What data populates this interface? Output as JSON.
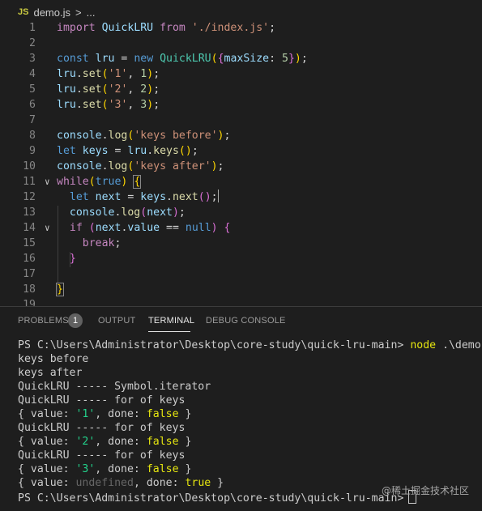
{
  "breadcrumb": {
    "file_icon": "JS",
    "file": "demo.js",
    "separator": ">",
    "ellipsis": "..."
  },
  "editor": {
    "lines": [
      {
        "num": "1",
        "tokens": [
          {
            "t": "import",
            "c": "k"
          },
          {
            "t": " "
          },
          {
            "t": "QuickLRU",
            "c": "v"
          },
          {
            "t": " "
          },
          {
            "t": "from",
            "c": "k"
          },
          {
            "t": " "
          },
          {
            "t": "'./index.js'",
            "c": "s"
          },
          {
            "t": ";",
            "c": "p"
          }
        ]
      },
      {
        "num": "2",
        "tokens": []
      },
      {
        "num": "3",
        "tokens": [
          {
            "t": "const",
            "c": "d"
          },
          {
            "t": " "
          },
          {
            "t": "lru",
            "c": "v"
          },
          {
            "t": " = ",
            "c": "p"
          },
          {
            "t": "new",
            "c": "d"
          },
          {
            "t": " "
          },
          {
            "t": "QuickLRU",
            "c": "t"
          },
          {
            "t": "(",
            "c": "b1"
          },
          {
            "t": "{",
            "c": "b2"
          },
          {
            "t": "maxSize",
            "c": "v"
          },
          {
            "t": ": ",
            "c": "p"
          },
          {
            "t": "5",
            "c": "n"
          },
          {
            "t": "}",
            "c": "b2"
          },
          {
            "t": ")",
            "c": "b1"
          },
          {
            "t": ";",
            "c": "p"
          }
        ]
      },
      {
        "num": "4",
        "tokens": [
          {
            "t": "lru",
            "c": "v"
          },
          {
            "t": ".",
            "c": "p"
          },
          {
            "t": "set",
            "c": "f"
          },
          {
            "t": "(",
            "c": "b1"
          },
          {
            "t": "'1'",
            "c": "s"
          },
          {
            "t": ", ",
            "c": "p"
          },
          {
            "t": "1",
            "c": "n"
          },
          {
            "t": ")",
            "c": "b1"
          },
          {
            "t": ";",
            "c": "p"
          }
        ]
      },
      {
        "num": "5",
        "tokens": [
          {
            "t": "lru",
            "c": "v"
          },
          {
            "t": ".",
            "c": "p"
          },
          {
            "t": "set",
            "c": "f"
          },
          {
            "t": "(",
            "c": "b1"
          },
          {
            "t": "'2'",
            "c": "s"
          },
          {
            "t": ", ",
            "c": "p"
          },
          {
            "t": "2",
            "c": "n"
          },
          {
            "t": ")",
            "c": "b1"
          },
          {
            "t": ";",
            "c": "p"
          }
        ]
      },
      {
        "num": "6",
        "tokens": [
          {
            "t": "lru",
            "c": "v"
          },
          {
            "t": ".",
            "c": "p"
          },
          {
            "t": "set",
            "c": "f"
          },
          {
            "t": "(",
            "c": "b1"
          },
          {
            "t": "'3'",
            "c": "s"
          },
          {
            "t": ", ",
            "c": "p"
          },
          {
            "t": "3",
            "c": "n"
          },
          {
            "t": ")",
            "c": "b1"
          },
          {
            "t": ";",
            "c": "p"
          }
        ]
      },
      {
        "num": "7",
        "tokens": []
      },
      {
        "num": "8",
        "tokens": [
          {
            "t": "console",
            "c": "v"
          },
          {
            "t": ".",
            "c": "p"
          },
          {
            "t": "log",
            "c": "f"
          },
          {
            "t": "(",
            "c": "b1"
          },
          {
            "t": "'keys before'",
            "c": "s"
          },
          {
            "t": ")",
            "c": "b1"
          },
          {
            "t": ";",
            "c": "p"
          }
        ]
      },
      {
        "num": "9",
        "tokens": [
          {
            "t": "let",
            "c": "d"
          },
          {
            "t": " "
          },
          {
            "t": "keys",
            "c": "v"
          },
          {
            "t": " = ",
            "c": "p"
          },
          {
            "t": "lru",
            "c": "v"
          },
          {
            "t": ".",
            "c": "p"
          },
          {
            "t": "keys",
            "c": "f"
          },
          {
            "t": "(",
            "c": "b1"
          },
          {
            "t": ")",
            "c": "b1"
          },
          {
            "t": ";",
            "c": "p"
          }
        ]
      },
      {
        "num": "10",
        "tokens": [
          {
            "t": "console",
            "c": "v"
          },
          {
            "t": ".",
            "c": "p"
          },
          {
            "t": "log",
            "c": "f"
          },
          {
            "t": "(",
            "c": "b1"
          },
          {
            "t": "'keys after'",
            "c": "s"
          },
          {
            "t": ")",
            "c": "b1"
          },
          {
            "t": ";",
            "c": "p"
          }
        ]
      },
      {
        "num": "11",
        "fold": true,
        "tokens": [
          {
            "t": "while",
            "c": "k"
          },
          {
            "t": "(",
            "c": "b1"
          },
          {
            "t": "true",
            "c": "d"
          },
          {
            "t": ")",
            "c": "b1"
          },
          {
            "t": " "
          },
          {
            "t": "{",
            "c": "b1",
            "box": true
          }
        ]
      },
      {
        "num": "12",
        "cursor": true,
        "tokens": [
          {
            "t": "  "
          },
          {
            "t": "let",
            "c": "d"
          },
          {
            "t": " "
          },
          {
            "t": "next",
            "c": "v"
          },
          {
            "t": " = ",
            "c": "p"
          },
          {
            "t": "keys",
            "c": "v"
          },
          {
            "t": ".",
            "c": "p"
          },
          {
            "t": "next",
            "c": "f"
          },
          {
            "t": "(",
            "c": "b2"
          },
          {
            "t": ")",
            "c": "b2"
          },
          {
            "t": ";",
            "c": "p"
          }
        ]
      },
      {
        "num": "13",
        "tokens": [
          {
            "t": "  "
          },
          {
            "t": "console",
            "c": "v"
          },
          {
            "t": ".",
            "c": "p"
          },
          {
            "t": "log",
            "c": "f"
          },
          {
            "t": "(",
            "c": "b2"
          },
          {
            "t": "next",
            "c": "v"
          },
          {
            "t": ")",
            "c": "b2"
          },
          {
            "t": ";",
            "c": "p"
          }
        ]
      },
      {
        "num": "14",
        "fold": true,
        "tokens": [
          {
            "t": "  "
          },
          {
            "t": "if",
            "c": "k"
          },
          {
            "t": " "
          },
          {
            "t": "(",
            "c": "b2"
          },
          {
            "t": "next",
            "c": "v"
          },
          {
            "t": ".",
            "c": "p"
          },
          {
            "t": "value",
            "c": "v"
          },
          {
            "t": " == ",
            "c": "p"
          },
          {
            "t": "null",
            "c": "d"
          },
          {
            "t": ")",
            "c": "b2"
          },
          {
            "t": " "
          },
          {
            "t": "{",
            "c": "b2"
          }
        ]
      },
      {
        "num": "15",
        "tokens": [
          {
            "t": "    "
          },
          {
            "t": "break",
            "c": "k"
          },
          {
            "t": ";",
            "c": "p"
          }
        ]
      },
      {
        "num": "16",
        "tokens": [
          {
            "t": "  "
          },
          {
            "t": "}",
            "c": "b2"
          }
        ]
      },
      {
        "num": "17",
        "tokens": []
      },
      {
        "num": "18",
        "tokens": [
          {
            "t": "}",
            "c": "b1",
            "box": true
          }
        ]
      },
      {
        "num": "19",
        "tokens": []
      }
    ]
  },
  "panel": {
    "tabs": [
      {
        "label": "PROBLEMS",
        "badge": "1"
      },
      {
        "label": "OUTPUT"
      },
      {
        "label": "TERMINAL",
        "active": true
      },
      {
        "label": "DEBUG CONSOLE"
      }
    ]
  },
  "terminal": {
    "lines": [
      [
        {
          "t": "PS C:\\Users\\Administrator\\Desktop\\core-study\\quick-lru-main> "
        },
        {
          "t": "node",
          "c": "ty"
        },
        {
          "t": " .\\demo.js"
        }
      ],
      [
        {
          "t": "keys before"
        }
      ],
      [
        {
          "t": "keys after"
        }
      ],
      [
        {
          "t": "QuickLRU ----- Symbol.iterator"
        }
      ],
      [
        {
          "t": "QuickLRU ----- for of keys"
        }
      ],
      [
        {
          "t": "{ value: "
        },
        {
          "t": "'1'",
          "c": "tg"
        },
        {
          "t": ", done: "
        },
        {
          "t": "false",
          "c": "ty"
        },
        {
          "t": " }"
        }
      ],
      [
        {
          "t": "QuickLRU ----- for of keys"
        }
      ],
      [
        {
          "t": "{ value: "
        },
        {
          "t": "'2'",
          "c": "tg"
        },
        {
          "t": ", done: "
        },
        {
          "t": "false",
          "c": "ty"
        },
        {
          "t": " }"
        }
      ],
      [
        {
          "t": "QuickLRU ----- for of keys"
        }
      ],
      [
        {
          "t": "{ value: "
        },
        {
          "t": "'3'",
          "c": "tg"
        },
        {
          "t": ", done: "
        },
        {
          "t": "false",
          "c": "ty"
        },
        {
          "t": " }"
        }
      ],
      [
        {
          "t": "{ value: "
        },
        {
          "t": "undefined",
          "c": "tgr"
        },
        {
          "t": ", done: "
        },
        {
          "t": "true",
          "c": "ty"
        },
        {
          "t": " }"
        }
      ],
      [
        {
          "t": "PS C:\\Users\\Administrator\\Desktop\\core-study\\quick-lru-main>"
        }
      ]
    ]
  },
  "watermark": "@稀土掘金技术社区"
}
